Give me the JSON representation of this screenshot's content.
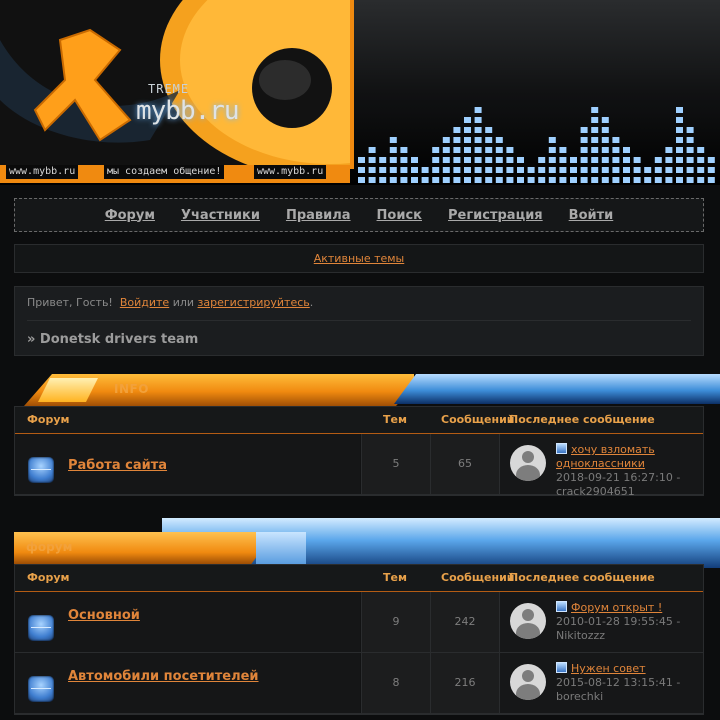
{
  "banner": {
    "logo_word": "mybb.ru",
    "logo_small": "TREME",
    "ticker": [
      "www.mybb.ru",
      "мы создаем общение!",
      "www.mybb.ru"
    ],
    "accent": "#f08a10",
    "eq_color": "#9fd0ff"
  },
  "nav": {
    "items": [
      "Форум",
      "Участники",
      "Правила",
      "Поиск",
      "Регистрация",
      "Войти"
    ]
  },
  "active_topics": "Активные темы",
  "greeting": {
    "prefix": "Привет, Гость!",
    "login": "Войдите",
    "or": "или",
    "register": "зарегистрируйтесь",
    "dot": ".",
    "crumb": "» Donetsk drivers team"
  },
  "headers": {
    "forum": "Форум",
    "topics": "Тем",
    "posts": "Сообщений",
    "last": "Последнее сообщение"
  },
  "categories": [
    {
      "label": "INFO",
      "forums": [
        {
          "name": "Работа сайта",
          "topics": "5",
          "posts": "65",
          "last_title": "хочу взломать одноклассники",
          "last_date": "2018-09-21 16:27:10 -",
          "last_user": "crack2904651"
        }
      ]
    },
    {
      "label": "форум",
      "forums": [
        {
          "name": "Основной",
          "topics": "9",
          "posts": "242",
          "last_title": "Форум открыт !",
          "last_date": "2010-01-28 19:55:45 -",
          "last_user": "Nikitozzz"
        },
        {
          "name": "Автомобили посетителей",
          "topics": "8",
          "posts": "216",
          "last_title": "Нужен совет",
          "last_date": "2015-08-12 13:15:41 -",
          "last_user": "borechki"
        }
      ]
    }
  ]
}
